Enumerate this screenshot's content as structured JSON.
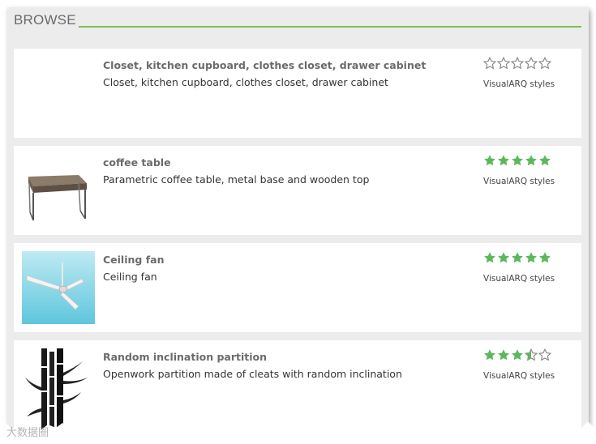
{
  "header": {
    "title": "BROWSE"
  },
  "colors": {
    "accent": "#7cbf5a",
    "star_filled": "#5cb85c",
    "star_empty": "#8a8a8a",
    "panel_bg": "#ececec"
  },
  "items": [
    {
      "title": "Closet, kitchen cupboard, clothes closet, drawer cabinet",
      "description": "Closet, kitchen cupboard, clothes closet, drawer cabinet",
      "rating": 0,
      "source": "VisualARQ styles",
      "thumbnail_icon": "none"
    },
    {
      "title": "coffee table",
      "description": "Parametric coffee table, metal base and wooden top",
      "rating": 5,
      "source": "VisualARQ styles",
      "thumbnail_icon": "coffee-table-icon"
    },
    {
      "title": "Ceiling fan",
      "description": "Ceiling fan",
      "rating": 5,
      "source": "VisualARQ styles",
      "thumbnail_icon": "ceiling-fan-icon"
    },
    {
      "title": "Random inclination partition",
      "description": "Openwork partition made of cleats with random inclination",
      "rating": 3.5,
      "source": "VisualARQ styles",
      "thumbnail_icon": "bamboo-partition-icon"
    }
  ],
  "watermark": "大数据圈"
}
